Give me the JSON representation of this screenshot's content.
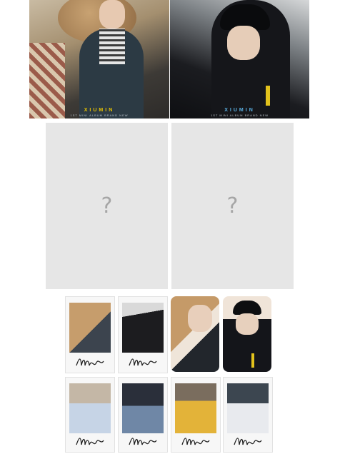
{
  "covers": [
    {
      "title": "XIUMIN",
      "subtitle": "1ST MINI ALBUM BRAND NEW",
      "title_color": "#e7c200"
    },
    {
      "title": "XIUMIN",
      "subtitle": "1ST MINI ALBUM BRAND NEW",
      "title_color": "#5aaee0"
    }
  ],
  "placeholders": [
    {
      "symbol": "?"
    },
    {
      "symbol": "?"
    }
  ],
  "photocards_row1": [
    {
      "kind": "polaroid",
      "scene": "with teddy bear"
    },
    {
      "kind": "polaroid",
      "scene": "hooded portrait"
    },
    {
      "kind": "card",
      "scene": "with teddy bear"
    },
    {
      "kind": "card",
      "scene": "cap and hoodie"
    }
  ],
  "photocards_row2": [
    {
      "kind": "polaroid",
      "scene": "white shirt"
    },
    {
      "kind": "polaroid",
      "scene": "denim jacket"
    },
    {
      "kind": "polaroid",
      "scene": "yellow cap"
    },
    {
      "kind": "polaroid",
      "scene": "suit and tie"
    }
  ]
}
